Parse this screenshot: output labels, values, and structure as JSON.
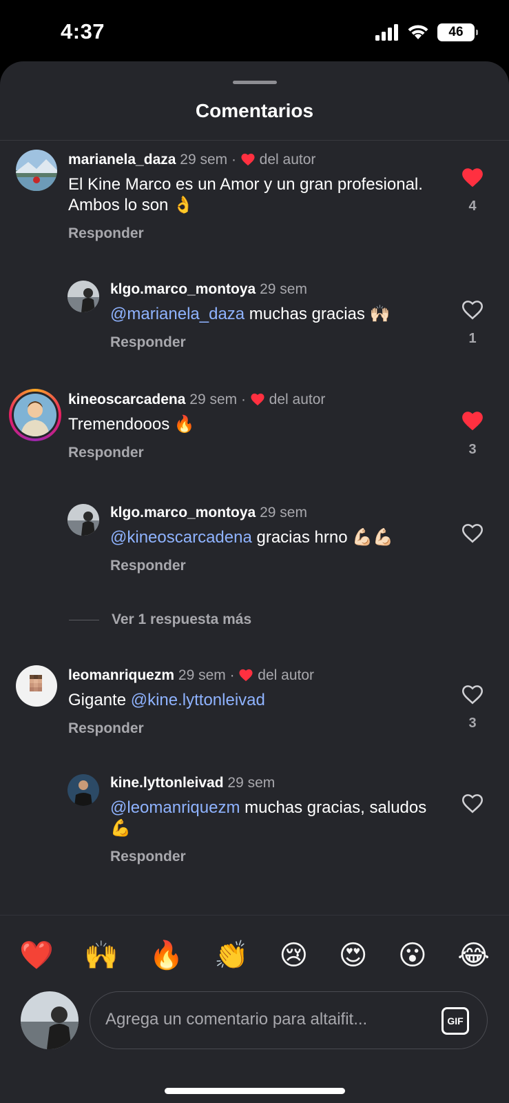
{
  "status_bar": {
    "time": "4:37",
    "battery": "46"
  },
  "sheet": {
    "title": "Comentarios"
  },
  "comments": [
    {
      "username": "marianela_daza",
      "time": "29 sem",
      "author_like_label": "del autor",
      "text": "El Kine Marco es un Amor y un gran profesional.  Ambos lo son 👌",
      "reply_label": "Responder",
      "liked": true,
      "like_count": "4"
    },
    {
      "username": "klgo.marco_montoya",
      "time": "29 sem",
      "mention": "@marianela_daza",
      "text": " muchas gracias 🙌🏻",
      "reply_label": "Responder",
      "liked": false,
      "like_count": "1"
    },
    {
      "username": "kineoscarcadena",
      "time": "29 sem",
      "author_like_label": "del autor",
      "text": "Tremendooos 🔥",
      "reply_label": "Responder",
      "liked": true,
      "like_count": "3"
    },
    {
      "username": "klgo.marco_montoya",
      "time": "29 sem",
      "mention": "@kineoscarcadena",
      "text": " gracias hrno 💪🏻💪🏻",
      "reply_label": "Responder",
      "liked": false,
      "like_count": ""
    },
    {
      "username": "leomanriquezm",
      "time": "29 sem",
      "author_like_label": "del autor",
      "text": "Gigante ",
      "mention": "@kine.lyttonleivad",
      "reply_label": "Responder",
      "liked": false,
      "like_count": "3"
    },
    {
      "username": "kine.lyttonleivad",
      "time": "29 sem",
      "mention": "@leomanriquezm",
      "text": " muchas gracias, saludos 💪",
      "reply_label": "Responder",
      "liked": false,
      "like_count": ""
    }
  ],
  "more_replies": "Ver 1 respuesta más",
  "emoji_bar": [
    "❤️",
    "🙌",
    "🔥",
    "👏",
    "😢",
    "😍",
    "😮",
    "😂"
  ],
  "composer": {
    "placeholder": "Agrega un comentario para altaifit...",
    "gif_label": "GIF"
  },
  "colors": {
    "background": "#25262b",
    "mention": "#8fb3ff",
    "liked_heart": "#ff3040",
    "secondary_text": "#a8a8ad"
  },
  "icons": {
    "like_filled": "heart-filled-icon",
    "like_outline": "heart-outline-icon",
    "gif": "gif-icon",
    "signal": "signal-icon",
    "wifi": "wifi-icon",
    "battery": "battery-icon"
  }
}
